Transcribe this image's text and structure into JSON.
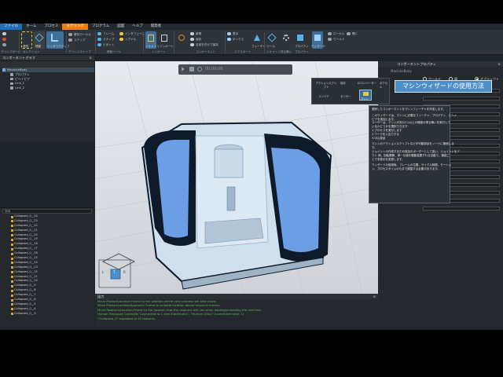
{
  "menu": {
    "items": [
      "ファイル",
      "ホーム",
      "プロセス",
      "モデリング",
      "プログラム",
      "図面",
      "ヘルプ",
      "開発者"
    ],
    "active_index": 3
  },
  "ribbon": {
    "items": {
      "select": "選択",
      "move": "移動",
      "frame": "フレーム",
      "snap": "スナップ",
      "pivot": "ピボット",
      "interactive": "インタラクティブ",
      "feature": "フィーチャ",
      "property": "プロパティ",
      "wizard": "ウィザード",
      "import": "インポート",
      "new": "新規",
      "save": "保存",
      "open": "開く",
      "save_as": "名前を付けて保存",
      "tool": "ツール",
      "interface": "インタフェース",
      "cycle": "シグナル",
      "local": "ローカル",
      "global": "ワールド",
      "snap_frame": "ジオメトリ",
      "parent_local": "親をローカル",
      "constraint": "ステップ",
      "pivot_move": "ボックス",
      "hide": "表示"
    },
    "groups": {
      "clipboard": "クリップボード",
      "selection": "セレクション",
      "grid_snap": "グリッドスナップ",
      "manipulation": "移動ツール",
      "import": "インポート",
      "export": "コンポーネント",
      "features": "エクスポート",
      "geometry": "ジオメトリ",
      "behaviours": "振る舞い",
      "properties": "プロパティ",
      "wizards": "コンポーネントウィザード"
    }
  },
  "component_graph": {
    "title": "コンポーネントグラフ",
    "root": "MachineBody",
    "children": [
      "プロパティ",
      "ビヘイビア",
      "Link_1",
      "Link_2"
    ]
  },
  "component_list": {
    "search_placeholder": "検索",
    "items": [
      "Collapsed_0__24",
      "Collapsed_0__23",
      "Collapsed_0__22",
      "Collapsed_0__21",
      "Collapsed_0__20",
      "Collapsed_0__19",
      "Collapsed_0__18",
      "Collapsed_0__17",
      "Collapsed_0__16",
      "Collapsed_0__15",
      "Collapsed_0__14",
      "Collapsed_0__13",
      "Collapsed_0__12",
      "Collapsed_0__11",
      "Collapsed_0__10",
      "Collapsed_0__9",
      "Collapsed_0__8",
      "Collapsed_0__7",
      "Collapsed_0__6",
      "Collapsed_0__5",
      "Collapsed_0__4",
      "Collapsed_0__3"
    ]
  },
  "viewport": {
    "timer": "00:00:00",
    "navcube": {
      "left": "L",
      "top": "T",
      "right": "R"
    }
  },
  "output": {
    "title": "出力",
    "lines": [
      "Move ProductLocation Frame to the position where your process will take place.",
      "Move ProductLocationApproach Frame to suitable location above resource frames.",
      "Move ResourceLocation Frame to the location that the resource will use when loading/unloading the machine.",
      "Human Transport Controller Connected to 1 new Interface(s) : \"Human (Oku)\" (connected total: 1)",
      "\"Collapsed_0\" exploded to 50 features."
    ]
  },
  "wizard_dropdown": {
    "items": [
      "アクションスクリプト",
      "保存",
      "IOコンバーター",
      "ボクセル",
      "コンベア",
      "センサー",
      "マシン"
    ]
  },
  "banner": {
    "text": "マシンウィザードの使用方法"
  },
  "properties_panel": {
    "title": "コンポーネントプロパティ",
    "component": "MachineBody",
    "radios": [
      "ワールド",
      "親",
      "オブジェクト"
    ],
    "selected_radio": 2
  },
  "tooltip": {
    "lines": [
      "選択したコンポーネントをマシンフィーチャを作成します。",
      "",
      "このウィザードは、マシンに必要なフィーチャ、プロパティ、ビヘイ",
      "ビアを追加します。",
      "ユーザーは、マシンが次の1つ以上の機能の振る舞いを実行して",
      "いるかどうかを選択できます:",
      "1.プロセスを実行します",
      "2.ワークを入出力する",
      "3.中心部品",
      "",
      "マシンのアクションスクリプトなどが可動部品をノードに格納しま",
      "す。",
      "ジョイントの作成するため追加のボーダーとして扱い、ジョイントをア",
      "ウト 側、回転関節、単一な値を駆動装置ずれる自動で、機能ご",
      "とで非表示を変更します。",
      "",
      "ウィザードの使用後、フレームの位置、サイクル時間、モーショ",
      "ン、プロセスタイムのも手で調整する必要があります。"
    ]
  },
  "colors": {
    "accent": "#e6801f",
    "file_menu": "#1e6fb8",
    "banner": "#4d8ec9",
    "machine_blue": "#6c9ee6",
    "machine_dark": "#0e1a2a",
    "output_text": "#5fb85a"
  }
}
